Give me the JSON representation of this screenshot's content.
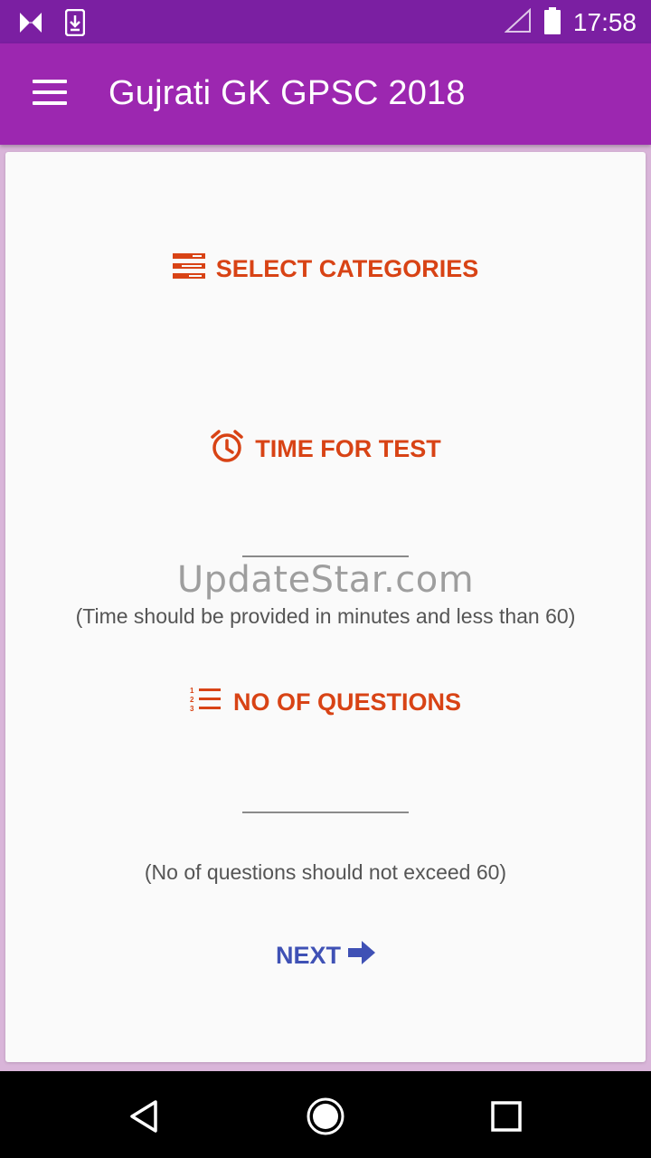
{
  "status_bar": {
    "time": "17:58",
    "icons": [
      "notification-n-icon",
      "download-icon",
      "signal-icon",
      "battery-icon"
    ]
  },
  "app_bar": {
    "title": "Gujrati GK GPSC 2018",
    "menu_icon": "hamburger-menu-icon"
  },
  "sections": {
    "categories_label": "SELECT CATEGORIES",
    "time_label": "TIME FOR TEST",
    "time_value": "",
    "time_hint": "(Time should be provided in minutes and less than 60)",
    "questions_label": "NO OF QUESTIONS",
    "questions_value": "",
    "questions_hint": "(No of questions should not exceed 60)"
  },
  "watermark": "UpdateStar.com",
  "next_label": "NEXT",
  "colors": {
    "status_bar": "#7b1fa2",
    "app_bar": "#9c27b0",
    "accent_orange": "#d84315",
    "accent_blue": "#3f51b5",
    "card_bg": "#fafafa"
  },
  "nav_bar": {
    "icons": [
      "back-icon",
      "home-icon",
      "recents-icon"
    ]
  }
}
